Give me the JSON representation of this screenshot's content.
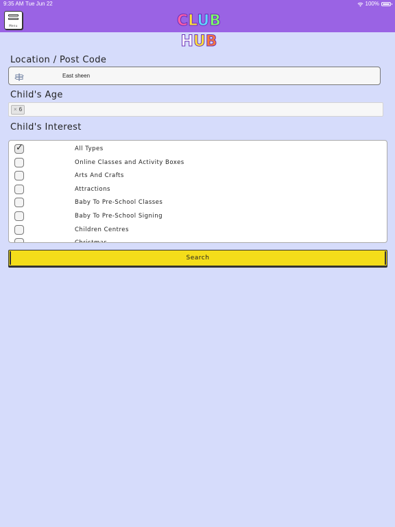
{
  "status_bar": {
    "time": "9:35 AM",
    "date": "Tue Jun 22",
    "battery": "100%"
  },
  "header": {
    "menu_label": "Menu",
    "logo_text": "CLUB HUB"
  },
  "colors": {
    "header": "#9a63e4",
    "background": "#d6dcfb",
    "search_button": "#f4dd1a"
  },
  "location": {
    "label": "Location / Post Code",
    "value": "East sheen"
  },
  "age": {
    "label": "Child's Age",
    "selected": "6"
  },
  "interest": {
    "label": "Child's Interest",
    "items": [
      {
        "label": "All Types",
        "checked": true
      },
      {
        "label": "Online Classes and Activity Boxes",
        "checked": false
      },
      {
        "label": "Arts And Crafts",
        "checked": false
      },
      {
        "label": "Attractions",
        "checked": false
      },
      {
        "label": "Baby To Pre-School Classes",
        "checked": false
      },
      {
        "label": "Baby To Pre-School Signing",
        "checked": false
      },
      {
        "label": "Children Centres",
        "checked": false
      },
      {
        "label": "Christmas",
        "checked": false
      }
    ]
  },
  "search_button": {
    "label": "Search"
  }
}
